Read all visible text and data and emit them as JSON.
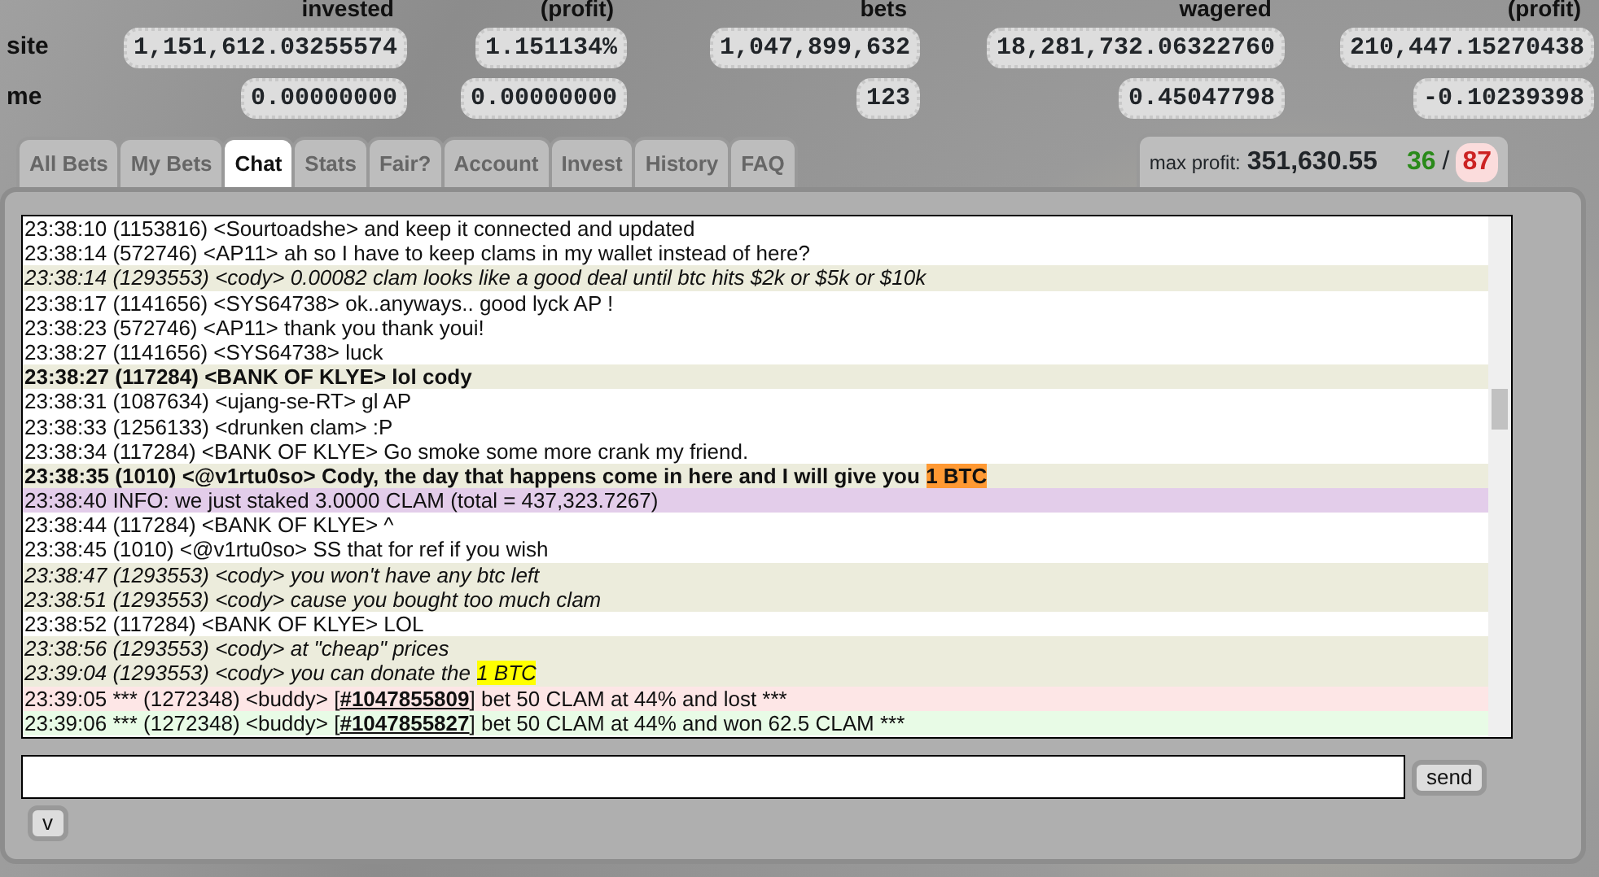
{
  "stats": {
    "columns": [
      "invested",
      "(profit)",
      "bets",
      "wagered",
      "(profit)"
    ],
    "rows": [
      {
        "label": "site",
        "values": [
          "1,151,612.03255574",
          "1.151134%",
          "1,047,899,632",
          "18,281,732.06322760",
          "210,447.15270438"
        ]
      },
      {
        "label": "me",
        "values": [
          "0.00000000",
          "0.00000000",
          "123",
          "0.45047798",
          "-0.10239398"
        ]
      }
    ]
  },
  "tabs": [
    {
      "label": "All Bets",
      "selected": false
    },
    {
      "label": "My Bets",
      "selected": false
    },
    {
      "label": "Chat",
      "selected": true
    },
    {
      "label": "Stats",
      "selected": false
    },
    {
      "label": "Fair?",
      "selected": false
    },
    {
      "label": "Account",
      "selected": false
    },
    {
      "label": "Invest",
      "selected": false
    },
    {
      "label": "History",
      "selected": false
    },
    {
      "label": "FAQ",
      "selected": false
    }
  ],
  "max_profit": {
    "label": "max profit:",
    "value": "351,630.55",
    "first_count": "36",
    "separator": "/",
    "second_count": "87"
  },
  "chat": [
    {
      "kind": "chat",
      "bold": false,
      "italic": false,
      "highlighted": false,
      "parts": [
        {
          "text": "23:38:10 (1153816) <Sourtoadshe> and keep it connected and updated"
        }
      ]
    },
    {
      "kind": "chat",
      "bold": false,
      "italic": false,
      "highlighted": false,
      "parts": [
        {
          "text": "23:38:14 (572746) <AP11> ah so I have to keep clams in my wallet instead of here?"
        }
      ]
    },
    {
      "kind": "chat",
      "bold": false,
      "italic": true,
      "highlighted": true,
      "parts": [
        {
          "text": "23:38:14 (1293553) <cody> 0.00082 clam looks like a good deal until btc hits $2k or $5k or $10k"
        }
      ]
    },
    {
      "kind": "chat",
      "bold": false,
      "italic": false,
      "highlighted": false,
      "parts": [
        {
          "text": "23:38:17 (1141656) <SYS64738> ok..anyways.. good lyck AP !"
        }
      ]
    },
    {
      "kind": "chat",
      "bold": false,
      "italic": false,
      "highlighted": false,
      "parts": [
        {
          "text": "23:38:23 (572746) <AP11> thank you thank youi!"
        }
      ]
    },
    {
      "kind": "chat",
      "bold": false,
      "italic": false,
      "highlighted": false,
      "parts": [
        {
          "text": "23:38:27 (1141656) <SYS64738> luck"
        }
      ]
    },
    {
      "kind": "chat",
      "bold": true,
      "italic": false,
      "highlighted": true,
      "parts": [
        {
          "text": "23:38:27 (117284) <BANK OF KLYE> lol cody"
        }
      ]
    },
    {
      "kind": "chat",
      "bold": false,
      "italic": false,
      "highlighted": false,
      "parts": [
        {
          "text": "23:38:31 (1087634) <ujang-se-RT> gl AP"
        }
      ]
    },
    {
      "kind": "chat",
      "bold": false,
      "italic": false,
      "highlighted": false,
      "parts": [
        {
          "text": "23:38:33 (1256133) <drunken clam> :P"
        }
      ]
    },
    {
      "kind": "chat",
      "bold": false,
      "italic": false,
      "highlighted": false,
      "parts": [
        {
          "text": "23:38:34 (117284) <BANK OF KLYE> Go smoke some more crank my friend."
        }
      ]
    },
    {
      "kind": "chat",
      "bold": true,
      "italic": false,
      "highlighted": true,
      "parts": [
        {
          "text": "23:38:35 (1010) <@v1rtu0so> Cody, the day that happens come in here and I will give you "
        },
        {
          "text": "1 BTC",
          "color": "#ff9933"
        }
      ]
    },
    {
      "kind": "info",
      "bold": false,
      "italic": false,
      "highlighted": false,
      "parts": [
        {
          "text": "23:38:40 INFO: we just staked 3.0000 CLAM (total = 437,323.7267)"
        }
      ]
    },
    {
      "kind": "chat",
      "bold": false,
      "italic": false,
      "highlighted": false,
      "parts": [
        {
          "text": "23:38:44 (117284) <BANK OF KLYE> ^"
        }
      ]
    },
    {
      "kind": "chat",
      "bold": false,
      "italic": false,
      "highlighted": false,
      "parts": [
        {
          "text": "23:38:45 (1010) <@v1rtu0so> SS that for ref if you wish"
        }
      ]
    },
    {
      "kind": "chat",
      "bold": false,
      "italic": true,
      "highlighted": true,
      "parts": [
        {
          "text": "23:38:47 (1293553) <cody> you won't have any btc left"
        }
      ]
    },
    {
      "kind": "chat",
      "bold": false,
      "italic": true,
      "highlighted": true,
      "parts": [
        {
          "text": "23:38:51 (1293553) <cody> cause you bought too much clam"
        }
      ]
    },
    {
      "kind": "chat",
      "bold": false,
      "italic": false,
      "highlighted": false,
      "parts": [
        {
          "text": "23:38:52 (117284) <BANK OF KLYE> LOL"
        }
      ]
    },
    {
      "kind": "chat",
      "bold": false,
      "italic": true,
      "highlighted": true,
      "parts": [
        {
          "text": "23:38:56 (1293553) <cody> at \"cheap\" prices"
        }
      ]
    },
    {
      "kind": "chat",
      "bold": false,
      "italic": true,
      "highlighted": true,
      "parts": [
        {
          "text": "23:39:04 (1293553) <cody> you can donate the "
        },
        {
          "text": "1 BTC",
          "color": "#ffff00"
        }
      ]
    },
    {
      "kind": "bet_lost",
      "bold": false,
      "italic": false,
      "highlighted": false,
      "parts": [
        {
          "text": "23:39:05 *** (1272348) <buddy> ["
        },
        {
          "text": "#1047855809",
          "link": true
        },
        {
          "text": "] bet 50 CLAM at 44% and lost ***"
        }
      ]
    },
    {
      "kind": "bet_won",
      "bold": false,
      "italic": false,
      "highlighted": false,
      "parts": [
        {
          "text": "23:39:06 *** (1272348) <buddy> ["
        },
        {
          "text": "#1047855827",
          "link": true
        },
        {
          "text": "] bet 50 CLAM at 44% and won 62.5 CLAM ***"
        }
      ]
    }
  ],
  "send_button": "send",
  "toggle_button": "v"
}
